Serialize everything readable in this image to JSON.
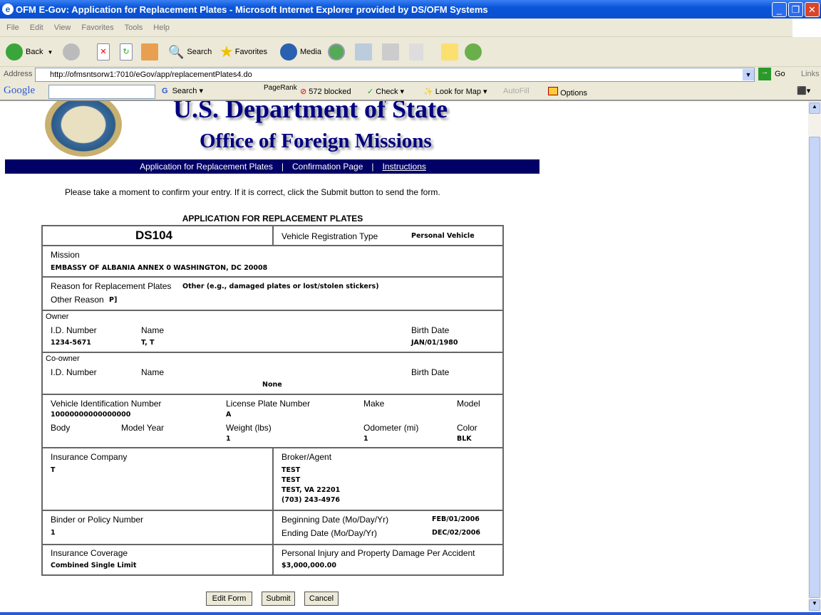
{
  "window": {
    "title": "OFM E-Gov: Application for Replacement Plates - Microsoft Internet Explorer provided by DS/OFM Systems"
  },
  "menu": [
    "File",
    "Edit",
    "View",
    "Favorites",
    "Tools",
    "Help"
  ],
  "toolbar": {
    "back": "Back",
    "search": "Search",
    "favorites": "Favorites",
    "media": "Media"
  },
  "address": {
    "label": "Address",
    "url": "http://ofmsntsorw1:7010/eGov/app/replacementPlates4.do",
    "go": "Go",
    "links": "Links"
  },
  "google": {
    "logo": "Google",
    "search": "Search",
    "pagerank": "PageRank",
    "blocked": "572 blocked",
    "check": "Check",
    "lookformap": "Look for Map",
    "autofill": "AutoFill",
    "options": "Options"
  },
  "header": {
    "title1": "U.S. Department of State",
    "title2": "Office of Foreign Missions",
    "seal": "UNITED STATES OF AMERICA"
  },
  "nav": {
    "item1": "Application for Replacement Plates",
    "sep": "|",
    "item2": "Confirmation Page",
    "item3": "Instructions"
  },
  "intro": "Please take a moment to confirm your entry. If it is correct, click the Submit button to send the form.",
  "form": {
    "heading": "APPLICATION FOR REPLACEMENT PLATES",
    "form_id": "DS104",
    "reg_type_label": "Vehicle Registration Type",
    "reg_type": "Personal Vehicle",
    "mission_label": "Mission",
    "mission": "EMBASSY OF ALBANIA ANNEX 0 WASHINGTON, DC 20008",
    "reason_label": "Reason for Replacement Plates",
    "reason": "Other (e.g., damaged plates or lost/stolen stickers)",
    "other_reason_label": "Other Reason",
    "other_reason": "P]",
    "owner": {
      "section": "Owner",
      "id_label": "I.D. Number",
      "name_label": "Name",
      "birth_label": "Birth Date",
      "id": "1234-5671",
      "name": "T, T",
      "birth": "JAN/01/1980"
    },
    "coowner": {
      "section": "Co-owner",
      "id_label": "I.D. Number",
      "name_label": "Name",
      "birth_label": "Birth Date",
      "value": "None"
    },
    "vehicle": {
      "vin_label": "Vehicle Identification Number",
      "vin": "10000000000000000",
      "plate_label": "License Plate Number",
      "plate": "A",
      "make_label": "Make",
      "model_label": "Model",
      "body_label": "Body",
      "year_label": "Model Year",
      "weight_label": "Weight (lbs)",
      "weight": "1",
      "odometer_label": "Odometer (mi)",
      "odometer": "1",
      "color_label": "Color",
      "color": "BLK"
    },
    "insurance": {
      "company_label": "Insurance Company",
      "company": "T",
      "broker_label": "Broker/Agent",
      "broker": [
        "TEST",
        "TEST",
        "TEST, VA 22201",
        "(703) 243-4976"
      ],
      "policy_label": "Binder or Policy Number",
      "policy": "1",
      "begin_label": "Beginning Date (Mo/Day/Yr)",
      "begin": "FEB/01/2006",
      "end_label": "Ending Date (Mo/Day/Yr)",
      "end": "DEC/02/2006",
      "coverage_label": "Insurance Coverage",
      "coverage": "Combined Single Limit",
      "injury_label": "Personal Injury and Property Damage Per Accident",
      "injury": "$3,000,000.00"
    }
  },
  "buttons": {
    "edit": "Edit Form",
    "submit": "Submit",
    "cancel": "Cancel"
  },
  "colors": {
    "nav_bg": "#000066",
    "title_blue": "#000080"
  }
}
